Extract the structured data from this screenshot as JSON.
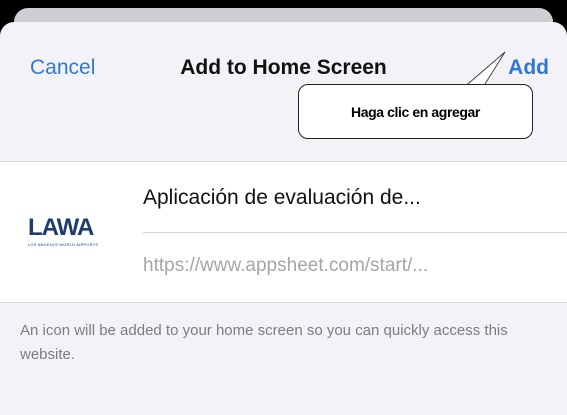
{
  "nav": {
    "cancel_label": "Cancel",
    "title": "Add to Home Screen",
    "add_label": "Add"
  },
  "app": {
    "logo_text": "LAWA",
    "logo_subtext": "LOS ANGELES WORLD AIRPORTS",
    "name": "Aplicación de evaluación de...",
    "url": "https://www.appsheet.com/start/..."
  },
  "description": "An icon will be added to your home screen so you can quickly access this website.",
  "callout": {
    "text": "Haga clic en agregar"
  },
  "colors": {
    "accent": "#2f79d4",
    "sheet_background": "#f2f2f7",
    "card_background": "#ffffff",
    "secondary_text": "#a5a5aa",
    "logo": "#1c3e6e"
  }
}
